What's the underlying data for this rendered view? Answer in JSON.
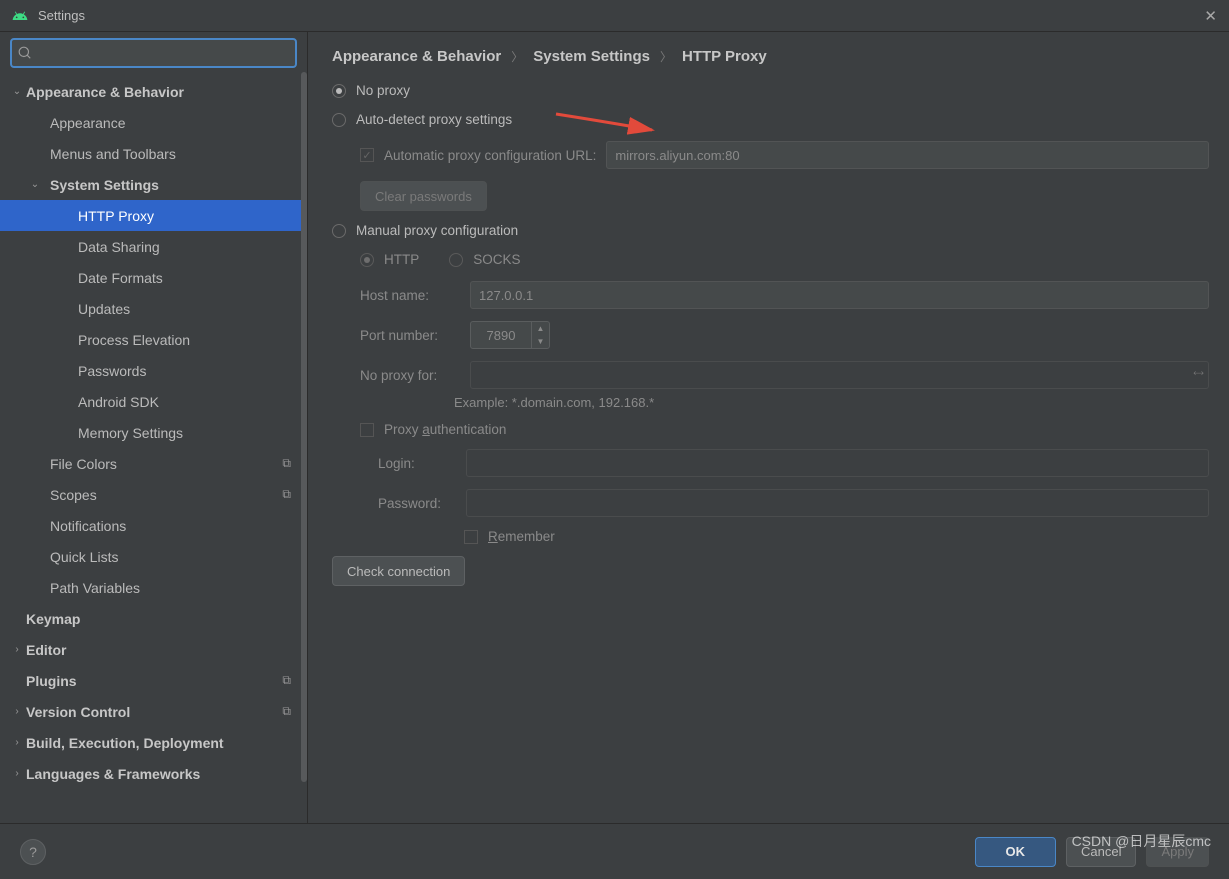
{
  "window": {
    "title": "Settings"
  },
  "search": {
    "placeholder": ""
  },
  "sidebar": {
    "items": [
      {
        "label": "Appearance & Behavior",
        "level": 0,
        "bold": true,
        "exp": "v"
      },
      {
        "label": "Appearance",
        "level": 1
      },
      {
        "label": "Menus and Toolbars",
        "level": 1
      },
      {
        "label": "System Settings",
        "level": 1,
        "bold": true,
        "exp": "v"
      },
      {
        "label": "HTTP Proxy",
        "level": 2,
        "selected": true
      },
      {
        "label": "Data Sharing",
        "level": 2
      },
      {
        "label": "Date Formats",
        "level": 2
      },
      {
        "label": "Updates",
        "level": 2
      },
      {
        "label": "Process Elevation",
        "level": 2
      },
      {
        "label": "Passwords",
        "level": 2
      },
      {
        "label": "Android SDK",
        "level": 2
      },
      {
        "label": "Memory Settings",
        "level": 2
      },
      {
        "label": "File Colors",
        "level": 1,
        "badge": true
      },
      {
        "label": "Scopes",
        "level": 1,
        "badge": true
      },
      {
        "label": "Notifications",
        "level": 1
      },
      {
        "label": "Quick Lists",
        "level": 1
      },
      {
        "label": "Path Variables",
        "level": 1
      },
      {
        "label": "Keymap",
        "level": 0,
        "bold": true
      },
      {
        "label": "Editor",
        "level": 0,
        "bold": true,
        "exp": ">"
      },
      {
        "label": "Plugins",
        "level": 0,
        "bold": true,
        "badge": true
      },
      {
        "label": "Version Control",
        "level": 0,
        "bold": true,
        "exp": ">",
        "badge": true
      },
      {
        "label": "Build, Execution, Deployment",
        "level": 0,
        "bold": true,
        "exp": ">"
      },
      {
        "label": "Languages & Frameworks",
        "level": 0,
        "bold": true,
        "exp": ">"
      }
    ]
  },
  "breadcrumb": {
    "a": "Appearance & Behavior",
    "b": "System Settings",
    "c": "HTTP Proxy"
  },
  "form": {
    "no_proxy": "No proxy",
    "auto_detect": "Auto-detect proxy settings",
    "auto_url_label": "Automatic proxy configuration URL:",
    "auto_url_value": "mirrors.aliyun.com:80",
    "clear_passwords": "Clear passwords",
    "manual": "Manual proxy configuration",
    "http": "HTTP",
    "socks": "SOCKS",
    "host_label": "Host name:",
    "host_value": "127.0.0.1",
    "port_label": "Port number:",
    "port_value": "7890",
    "noproxy_label": "No proxy for:",
    "noproxy_value": "",
    "example": "Example: *.domain.com, 192.168.*",
    "proxy_auth": "Proxy authentication",
    "login_label": "Login:",
    "login_value": "",
    "password_label": "Password:",
    "password_value": "",
    "remember": "Remember",
    "check_conn": "Check connection"
  },
  "footer": {
    "ok": "OK",
    "cancel": "Cancel",
    "apply": "Apply"
  },
  "watermark": "CSDN @日月星辰cmc"
}
